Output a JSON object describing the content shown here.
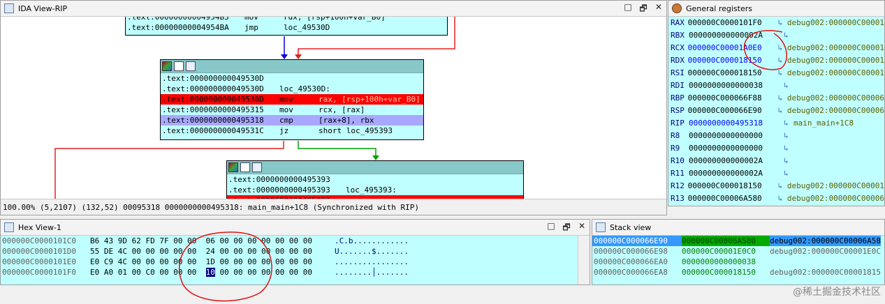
{
  "ida_view": {
    "title": "IDA View-RIP",
    "controls": [
      "□",
      "🗗",
      "✕"
    ],
    "blocks": [
      {
        "header": false,
        "lines": [
          {
            "addr": ".text:00000000004954B5",
            "mn": "mov",
            "op": "rdx, [rsp+100h+var_B0]",
            "style": "normal"
          },
          {
            "addr": ".text:00000000004954BA",
            "mn": "jmp",
            "op": "loc_49530D",
            "style": "normal"
          }
        ]
      },
      {
        "header": true,
        "lines": [
          {
            "addr": ".text:000000000049530D",
            "mn": "",
            "op": "",
            "style": "normal"
          },
          {
            "addr": ".text:000000000049530D",
            "mn": "loc_49530D:",
            "op": "",
            "style": "normal"
          },
          {
            "addr": ".text:000000000049530D",
            "mn": "mov",
            "op": "rax, [rsp+100h+var_B0]",
            "style": "bp"
          },
          {
            "addr": ".text:0000000000495315",
            "mn": "mov",
            "op": "rcx, [rax]",
            "style": "normal"
          },
          {
            "addr": ".text:0000000000495318",
            "mn": "cmp",
            "op": "[rax+8], rbx",
            "style": "ip"
          },
          {
            "addr": ".text:000000000049531C",
            "mn": "jz",
            "op": "short loc_495393",
            "style": "normal"
          }
        ]
      },
      {
        "header": true,
        "lines": [
          {
            "addr": ".text:0000000000495393",
            "mn": "",
            "op": "",
            "style": "normal"
          },
          {
            "addr": ".text:0000000000495393",
            "mn": "loc_495393:",
            "op": "",
            "style": "normal"
          },
          {
            "addr": ".text:0000000000495393",
            "mn": "",
            "op": "",
            "style": "bp"
          }
        ]
      }
    ],
    "status": "100.00% (5,2107) (132,52) 00095318 0000000000495318: main_main+1C8 (Synchronized with RIP)"
  },
  "registers": {
    "title": "General registers",
    "items": [
      {
        "name": "RAX",
        "value": "000000C0000101F0",
        "arrow": "↳",
        "desc": "debug002:000000C00001",
        "modified": false
      },
      {
        "name": "RBX",
        "value": "000000000000002A",
        "arrow": "↳",
        "desc": "",
        "modified": false
      },
      {
        "name": "RCX",
        "value": "000000C00001A0E0",
        "arrow": "↳",
        "desc": "debug002:000000C00001",
        "modified": true
      },
      {
        "name": "RDX",
        "value": "000000C000018150",
        "arrow": "↳",
        "desc": "debug002:000000C00001",
        "modified": true
      },
      {
        "name": "RSI",
        "value": "000000C000018150",
        "arrow": "↳",
        "desc": "debug002:000000C00001",
        "modified": false
      },
      {
        "name": "RDI",
        "value": "0000000000000038",
        "arrow": "↳",
        "desc": "",
        "modified": false
      },
      {
        "name": "RBP",
        "value": "000000C000066F88",
        "arrow": "↳",
        "desc": "debug002:000000C00006",
        "modified": false
      },
      {
        "name": "RSP",
        "value": "000000C000066E90",
        "arrow": "↳",
        "desc": "debug002:000000C00006",
        "modified": false
      },
      {
        "name": "RIP",
        "value": "0000000000495318",
        "arrow": "↳",
        "desc": "main_main+1C8",
        "modified": true
      },
      {
        "name": "R8",
        "value": "0000000000000000",
        "arrow": "↳",
        "desc": "",
        "modified": false
      },
      {
        "name": "R9",
        "value": "0000000000000000",
        "arrow": "↳",
        "desc": "",
        "modified": false
      },
      {
        "name": "R10",
        "value": "000000000000002A",
        "arrow": "↳",
        "desc": "",
        "modified": false
      },
      {
        "name": "R11",
        "value": "000000000000002A",
        "arrow": "↳",
        "desc": "",
        "modified": false
      },
      {
        "name": "R12",
        "value": "000000C000018150",
        "arrow": "↳",
        "desc": "debug002:000000C00001",
        "modified": false
      },
      {
        "name": "R13",
        "value": "000000C00006A580",
        "arrow": "↳",
        "desc": "debug002:000000C00006",
        "modified": false
      }
    ]
  },
  "hex_view": {
    "title": "Hex View-1",
    "controls": [
      "□",
      "🗗",
      "✕"
    ],
    "rows": [
      {
        "addr": "000000C0000101C0",
        "bytes": [
          "B6",
          "43",
          "9D",
          "62",
          "FD",
          "7F",
          "00",
          "00",
          "06",
          "00",
          "00",
          "00",
          "00",
          "00",
          "00",
          "00"
        ],
        "ascii": ".C.b............"
      },
      {
        "addr": "000000C0000101D0",
        "bytes": [
          "55",
          "DE",
          "4C",
          "00",
          "00",
          "00",
          "00",
          "00",
          "24",
          "00",
          "00",
          "00",
          "00",
          "00",
          "00",
          "00"
        ],
        "ascii": "U.......$......."
      },
      {
        "addr": "000000C0000101E0",
        "bytes": [
          "E0",
          "C9",
          "4C",
          "00",
          "00",
          "00",
          "00",
          "00",
          "1D",
          "00",
          "00",
          "00",
          "00",
          "00",
          "00",
          "00"
        ],
        "ascii": "................"
      },
      {
        "addr": "000000C0000101F0",
        "bytes": [
          "E0",
          "A0",
          "01",
          "00",
          "C0",
          "00",
          "00",
          "00",
          "10",
          "00",
          "00",
          "00",
          "00",
          "00",
          "00",
          "00"
        ],
        "ascii": "........│......."
      }
    ],
    "selected_byte_row": 3,
    "selected_byte_index": 8
  },
  "stack_view": {
    "title": "Stack view",
    "rows": [
      {
        "addr": "000000C000066E90",
        "value": "000000C00006A580",
        "desc": "debug002:000000C00006A58",
        "current": true
      },
      {
        "addr": "000000C000066E98",
        "value": "000000C00001E0C0",
        "desc": "debug002:000000C00001E0C",
        "current": false
      },
      {
        "addr": "000000C000066EA0",
        "value": "0000000000000038",
        "desc": "",
        "current": false
      },
      {
        "addr": "000000C000066EA8",
        "value": "000000C000018150",
        "desc": "debug002:000000C00001815",
        "current": false
      }
    ]
  },
  "watermark": "@稀土掘金技术社区",
  "colors": {
    "breakpoint": "#ff0000",
    "ip_line": "#a8a8ff",
    "block_bg": "#c0ffff",
    "annotation": "#e01010"
  }
}
